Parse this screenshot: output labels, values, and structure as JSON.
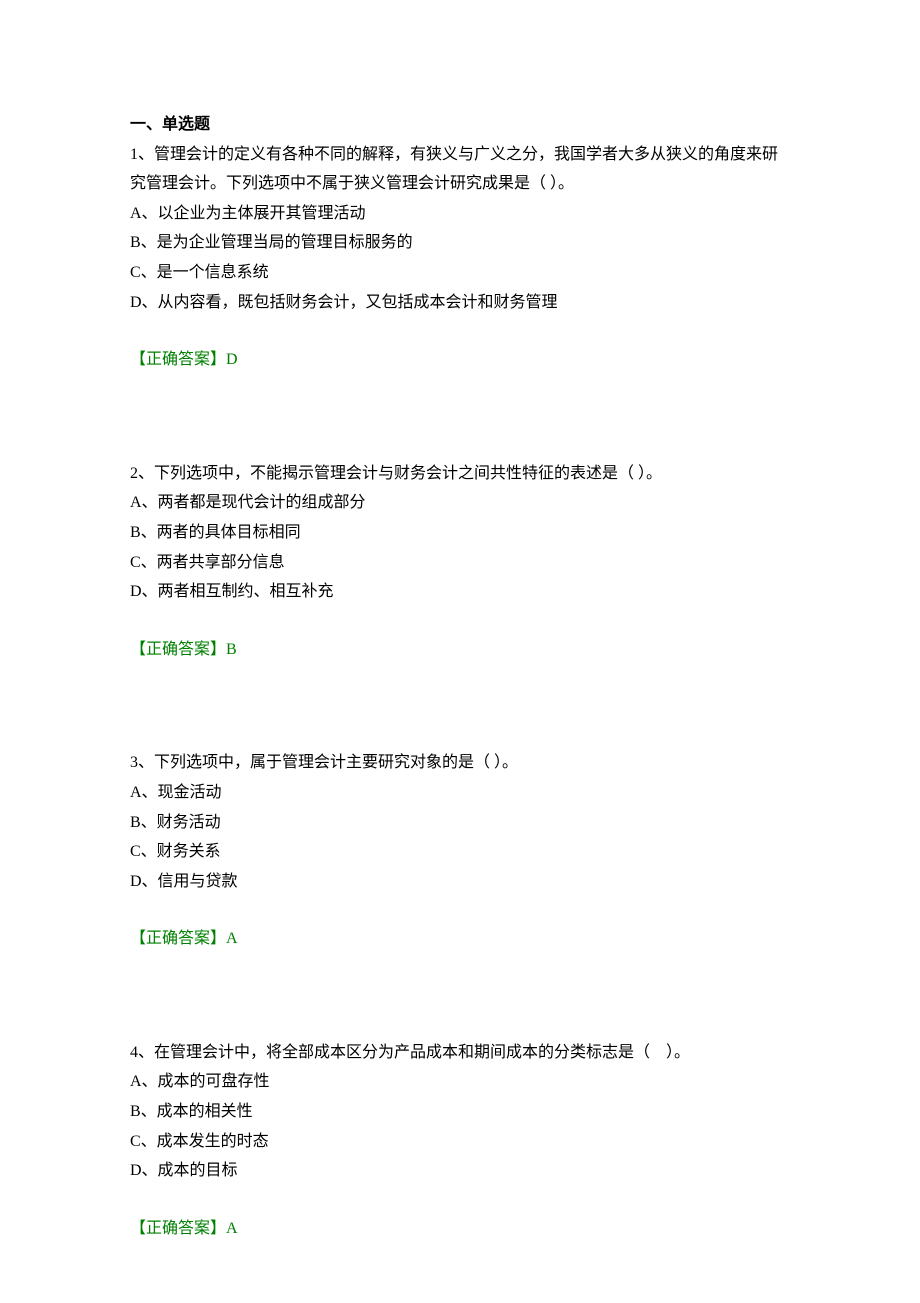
{
  "section_heading": "一、单选题",
  "answer_label": "【正确答案】",
  "questions": [
    {
      "prompt": "1、管理会计的定义有各种不同的解释，有狭义与广义之分，我国学者大多从狭义的角度来研究管理会计。下列选项中不属于狭义管理会计研究成果是（ ）。",
      "options": [
        "A、以企业为主体展开其管理活动",
        "B、是为企业管理当局的管理目标服务的",
        "C、是一个信息系统",
        "D、从内容看，既包括财务会计，又包括成本会计和财务管理"
      ],
      "answer": "D"
    },
    {
      "prompt": "2、下列选项中，不能揭示管理会计与财务会计之间共性特征的表述是（ ）。",
      "options": [
        "A、两者都是现代会计的组成部分",
        "B、两者的具体目标相同",
        "C、两者共享部分信息",
        "D、两者相互制约、相互补充"
      ],
      "answer": "B"
    },
    {
      "prompt": "3、下列选项中，属于管理会计主要研究对象的是（ ）。",
      "options": [
        "A、现金活动",
        "B、财务活动",
        "C、财务关系",
        "D、信用与贷款"
      ],
      "answer": "A"
    },
    {
      "prompt": "4、在管理会计中，将全部成本区分为产品成本和期间成本的分类标志是（　）。",
      "options": [
        "A、成本的可盘存性",
        "B、成本的相关性",
        "C、成本发生的时态",
        "D、成本的目标"
      ],
      "answer": "A"
    }
  ]
}
